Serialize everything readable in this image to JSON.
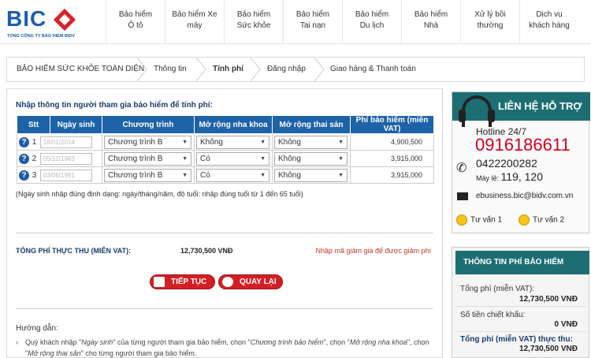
{
  "brand": {
    "name": "BIC",
    "tagline": "TỔNG CÔNG TY BẢO HIỂM BIDV"
  },
  "nav": [
    {
      "line1": "Bảo hiểm",
      "line2": "Ô tô"
    },
    {
      "line1": "Bảo hiểm Xe",
      "line2": "máy"
    },
    {
      "line1": "Bảo hiểm",
      "line2": "Sức khỏe"
    },
    {
      "line1": "Bảo hiểm",
      "line2": "Tai nạn"
    },
    {
      "line1": "Bảo hiểm",
      "line2": "Du lịch"
    },
    {
      "line1": "Bảo hiểm",
      "line2": "Nhà"
    },
    {
      "line1": "Xử lý bồi",
      "line2": "thường"
    },
    {
      "line1": "Dịch vụ",
      "line2": "khách hàng"
    }
  ],
  "breadcrumb": {
    "step1": "BẢO HIỂM SỨC KHỎE TOÀN DIỆN",
    "step2": "Thông tin",
    "step3": "Tính phí",
    "step4": "Đăng nhập",
    "step5": "Giao hàng & Thanh toán"
  },
  "form": {
    "heading": "Nhập thông tin người tham gia bảo hiểm để tính phí:",
    "columns": [
      "Stt",
      "Ngày sinh",
      "Chương trình",
      "Mở rộng nha khoa",
      "Mở rộng thai sản",
      "Phí bảo hiểm (miễn VAT)"
    ],
    "rows": [
      {
        "stt": "1",
        "dob": "18/01/2014",
        "program": "Chương trình B",
        "dental": "Không",
        "maternity": "Không",
        "fee": "4,900,500"
      },
      {
        "stt": "2",
        "dob": "05/12/1983",
        "program": "Chương trình B",
        "dental": "Có",
        "maternity": "Không",
        "fee": "3,915,000"
      },
      {
        "stt": "3",
        "dob": "03/06/1981",
        "program": "Chương trình B",
        "dental": "Có",
        "maternity": "Không",
        "fee": "3,915,000"
      }
    ],
    "note": "(Ngày sinh nhập đúng định dạng: ngày/tháng/năm, độ tuổi: nhập đúng tuổi từ 1 đến 65 tuổi)",
    "total_label": "TỔNG PHÍ THỰC THU (MIỄN VAT):",
    "total_value": "12,730,500 VNĐ",
    "discount_link": "Nhập mã giảm giá để được giảm phí",
    "continue_label": "TIẾP TỤC",
    "back_label": "QUAY LẠI"
  },
  "guide": {
    "title": "Hướng dẫn:",
    "p1": "Quý khách nhập \"",
    "e1": "Ngày sinh",
    "p2": "\" của từng người tham gia bảo hiểm, chọn \"",
    "e2": "Chương trình bảo hiểm",
    "p3": "\", chọn \"",
    "e3": "Mở rộng nha khoa",
    "p4": "\", chọn \"",
    "e4": "Mở rộng thai sản",
    "p5": "\" cho từng người tham gia bảo hiểm."
  },
  "support": {
    "title": "LIÊN HỆ HỖ TRỢ",
    "hotline_label": "Hotline 24/7",
    "hotline_number": "0916186611",
    "phone": "0422200282",
    "ext_label": "Máy lẻ:",
    "ext_value": "119, 120",
    "email": "ebusiness.bic@bidv.com.vn",
    "advisor1": "Tư vấn 1",
    "advisor2": "Tư vấn 2"
  },
  "fee_info": {
    "title": "THÔNG TIN PHÍ BẢO HIỂM",
    "total_label": "Tổng phí (miễn VAT):",
    "total_value": "12,730,500 VNĐ",
    "discount_label": "Số tiền chiết khấu:",
    "discount_value": "0 VNĐ",
    "net_label": "Tổng phí (miễn VAT) thực thu:",
    "net_value": "12,730,500 VNĐ"
  },
  "colors": {
    "brand_blue": "#1d63a8",
    "brand_red": "#d21f26",
    "support_teal": "#1c6e73",
    "hotline_red": "#d0021b"
  }
}
